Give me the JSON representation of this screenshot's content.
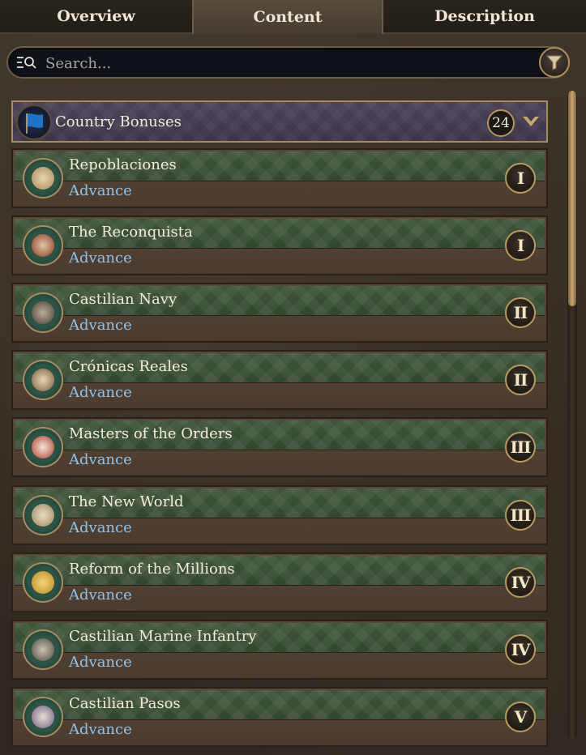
{
  "tabs": [
    "Overview",
    "Content",
    "Description"
  ],
  "active_tab": "Content",
  "search": {
    "placeholder": "Search..."
  },
  "category": {
    "title": "Country Bonuses",
    "count": "24"
  },
  "items": [
    {
      "title": "Repoblaciones",
      "subtitle": "Advance",
      "tier": "I",
      "icon": "map-scroll-icon"
    },
    {
      "title": "The Reconquista",
      "subtitle": "Advance",
      "tier": "I",
      "icon": "knight-shield-icon"
    },
    {
      "title": "Castilian Navy",
      "subtitle": "Advance",
      "tier": "II",
      "icon": "ship-icon"
    },
    {
      "title": "Crónicas Reales",
      "subtitle": "Advance",
      "tier": "II",
      "icon": "book-icon"
    },
    {
      "title": "Masters of the Orders",
      "subtitle": "Advance",
      "tier": "III",
      "icon": "order-banners-icon"
    },
    {
      "title": "The New World",
      "subtitle": "Advance",
      "tier": "III",
      "icon": "world-map-icon"
    },
    {
      "title": "Reform of the Millions",
      "subtitle": "Advance",
      "tier": "IV",
      "icon": "gold-coin-icon"
    },
    {
      "title": "Castilian Marine Infantry",
      "subtitle": "Advance",
      "tier": "IV",
      "icon": "soldier-icon"
    },
    {
      "title": "Castilian Pasos",
      "subtitle": "Advance",
      "tier": "V",
      "icon": "procession-icon"
    }
  ],
  "colors": {
    "advance_text": "#8fc2ea",
    "item_header": "#3f5538",
    "category_bg": "#4c4258",
    "gold_border": "#b8995f"
  }
}
